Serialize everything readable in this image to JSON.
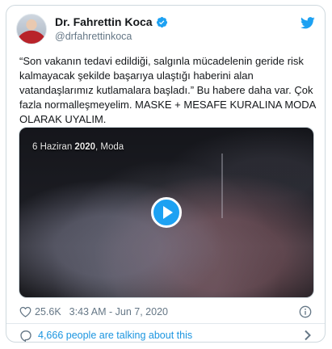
{
  "author": {
    "display_name": "Dr. Fahrettin Koca",
    "handle": "@drfahrettinkoca",
    "verified": true
  },
  "tweet": {
    "text": "“Son vakanın tedavi edildiği, salgınla mücadelenin geride risk kalmayacak şekilde başarıya ulaştığı haberini alan vatandaşlarımız kutlamalara başladı.” Bu habere daha var. Çok fazla normalleşmeyelim. MASKE + MESAFE KURALINA MODA OLARAK UYALIM."
  },
  "video": {
    "caption_prefix": "6 Haziran ",
    "caption_year": "2020",
    "caption_suffix": ", Moda"
  },
  "meta": {
    "like_count": "25.6K",
    "timestamp": "3:43 AM - Jun 7, 2020"
  },
  "footer": {
    "talking_text": "4,666 people are talking about this"
  },
  "colors": {
    "accent": "#1da1f2",
    "link": "#1b95e0",
    "muted": "#657786",
    "text": "#14171a",
    "border": "#cfd9de"
  },
  "icons": [
    "verified-badge-icon",
    "twitter-bird-icon",
    "play-icon",
    "heart-icon",
    "info-icon",
    "comment-icon",
    "chevron-right-icon"
  ]
}
